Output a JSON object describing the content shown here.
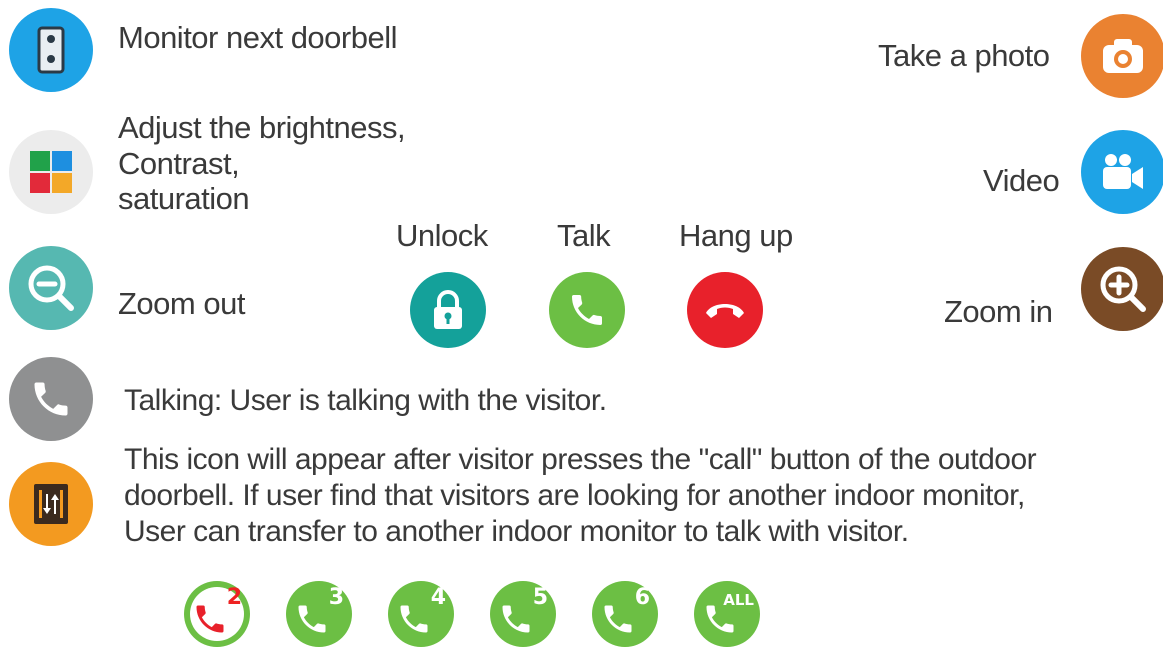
{
  "left": {
    "monitor_next": "Monitor next doorbell",
    "adjust_lines": [
      "Adjust the brightness,",
      "Contrast,",
      "saturation"
    ],
    "zoom_out": "Zoom out"
  },
  "right": {
    "take_photo": "Take a photo",
    "video": "Video",
    "zoom_in": "Zoom in"
  },
  "center": {
    "unlock": "Unlock",
    "talk": "Talk",
    "hang_up": "Hang up"
  },
  "talking_desc": "Talking: User is talking with the visitor.",
  "transfer_desc_lines": [
    "This icon will appear after visitor presses the \"call\" button of the outdoor",
    "doorbell.  If user find that visitors are looking for another indoor monitor,",
    "User can transfer to another indoor monitor to talk with visitor."
  ],
  "monitor_badges": [
    "2",
    "3",
    "4",
    "5",
    "6",
    "ALL"
  ],
  "colors": {
    "blue": "#1ea3e6",
    "orange": "#ea8231",
    "teal": "#56b8b1",
    "brown": "#7a4b26",
    "green": "#6cbf44",
    "red": "#e8212b",
    "gray": "#8f9091",
    "unlock_teal": "#14a19a"
  }
}
